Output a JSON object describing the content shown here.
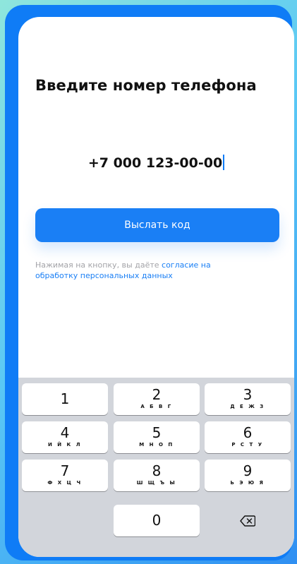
{
  "screen": {
    "title": "Введите номер телефона",
    "phone_value": "+7 000 123-00-00",
    "send_button_label": "Выслать код",
    "consent_text": "Нажимая на кнопку, вы даёте ",
    "consent_link": "согласие на обработку персональных данных"
  },
  "keyboard": {
    "keys": [
      {
        "digit": "1",
        "letters": ""
      },
      {
        "digit": "2",
        "letters": "А Б В Г"
      },
      {
        "digit": "3",
        "letters": "Д Е Ж З"
      },
      {
        "digit": "4",
        "letters": "И Й К Л"
      },
      {
        "digit": "5",
        "letters": "М Н О П"
      },
      {
        "digit": "6",
        "letters": "Р С Т У"
      },
      {
        "digit": "7",
        "letters": "Ф Х Ц Ч"
      },
      {
        "digit": "8",
        "letters": "Ш Щ Ъ Ы"
      },
      {
        "digit": "9",
        "letters": "Ь Э Ю Я"
      },
      {
        "digit": "0",
        "letters": ""
      }
    ],
    "backspace_icon": "backspace-icon"
  },
  "colors": {
    "accent": "#1a7ff5",
    "frame": "#0f7cf6",
    "keyboard_bg": "#d2d5db",
    "hint_text": "#a3a3a8"
  }
}
